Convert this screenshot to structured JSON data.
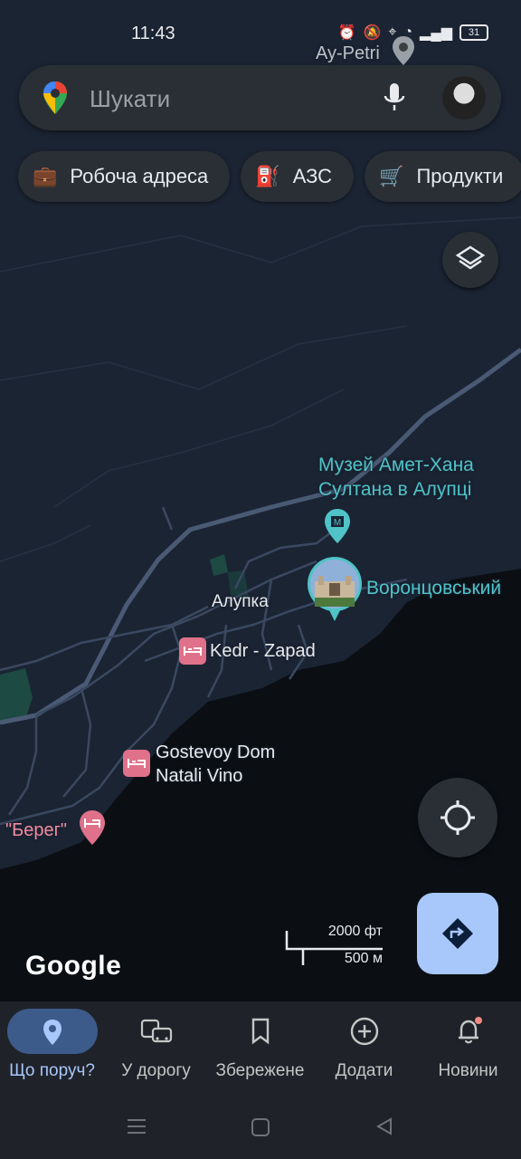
{
  "status_bar": {
    "time": "11:43",
    "battery": "31"
  },
  "search": {
    "placeholder": "Шукати"
  },
  "chips": [
    {
      "icon": "briefcase-icon",
      "label": "Робоча адреса"
    },
    {
      "icon": "fuel-icon",
      "label": "АЗС"
    },
    {
      "icon": "cart-icon",
      "label": "Продукти"
    }
  ],
  "map": {
    "labels": {
      "ay_petri": "Ay-Petri",
      "museum_line1": "Музей Амет-Хана",
      "museum_line2": "Султана в Алупці",
      "vorontsov": "Воронцовський",
      "alupka": "Алупка",
      "kedr": "Kedr - Zapad",
      "gostevoy_line1": "Gostevoy Dom",
      "gostevoy_line2": "Natali Vino",
      "bereg": "\"Берег\""
    },
    "scale": {
      "feet": "2000 фт",
      "meters": "500 м"
    },
    "attribution": "Google"
  },
  "bottom_nav": [
    {
      "label": "Що поруч?",
      "icon": "pin-icon",
      "active": true
    },
    {
      "label": "У дорогу",
      "icon": "commute-icon",
      "active": false
    },
    {
      "label": "Збережене",
      "icon": "bookmark-icon",
      "active": false
    },
    {
      "label": "Додати",
      "icon": "add-circle-icon",
      "active": false
    },
    {
      "label": "Новини",
      "icon": "bell-icon",
      "active": false
    }
  ],
  "colors": {
    "accent": "#a8c7fa",
    "water": "#0b0f14",
    "land": "#1b2433"
  }
}
